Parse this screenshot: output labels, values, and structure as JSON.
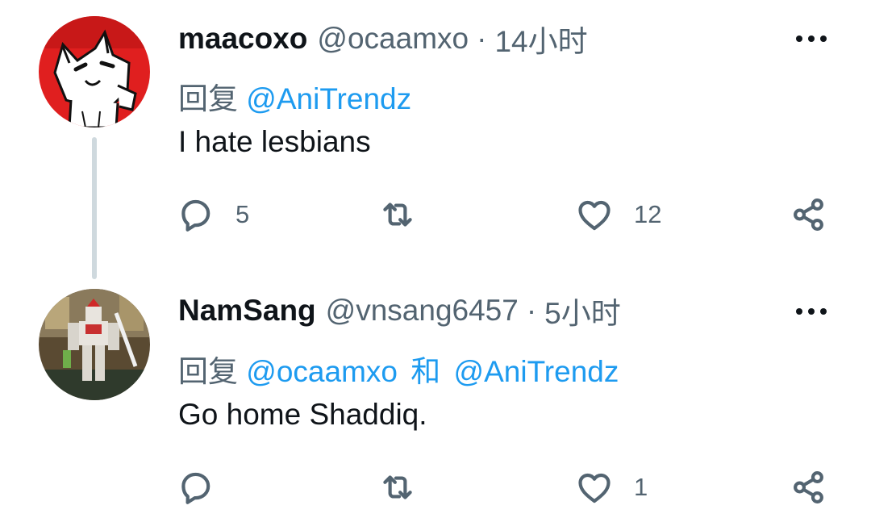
{
  "tweets": [
    {
      "display_name": "maacoxo",
      "handle": "@ocaamxo",
      "separator": "·",
      "time": "14小时",
      "reply_prefix": "回复",
      "reply_to": [
        "@AniTrendz"
      ],
      "reply_conjunction": "",
      "text": "I hate lesbians",
      "replies": "5",
      "retweets": "",
      "likes": "12",
      "avatar": "white-cat-drawing-on-red"
    },
    {
      "display_name": "NamSang",
      "handle": "@vnsang6457",
      "separator": "·",
      "time": "5小时",
      "reply_prefix": "回复",
      "reply_to": [
        "@ocaamxo",
        "@AniTrendz"
      ],
      "reply_conjunction": "和",
      "text": "Go home Shaddiq.",
      "replies": "",
      "retweets": "",
      "likes": "1",
      "avatar": "gundam-model-photo"
    }
  ],
  "icons": {
    "more": "more-horizontal-icon",
    "reply": "comment-bubble-icon",
    "retweet": "retweet-arrows-icon",
    "like": "heart-icon",
    "share": "share-nodes-icon"
  },
  "colors": {
    "text": "#0f1419",
    "secondary": "#536471",
    "link": "#1d9bf0",
    "thread_line": "#cfd9de"
  }
}
